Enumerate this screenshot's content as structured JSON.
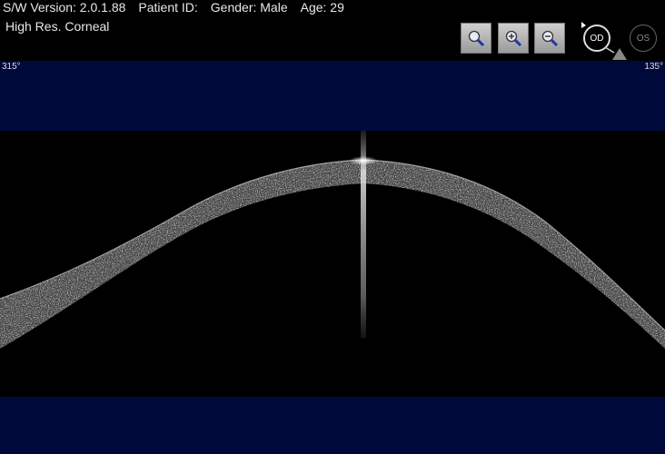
{
  "header": {
    "sw_version": "S/W Version: 2.0.1.88",
    "patient_id": "Patient ID:",
    "gender": "Gender: Male",
    "age": "Age: 29"
  },
  "scan_type": "High Res. Corneal",
  "toolbar": {
    "buttons": [
      {
        "name": "magnifier",
        "icon": "search-icon"
      },
      {
        "name": "zoom-in",
        "icon": "zoom-in-icon"
      },
      {
        "name": "zoom-out",
        "icon": "zoom-out-icon"
      }
    ],
    "eye_selector": {
      "od_label": "OD",
      "os_label": "OS",
      "selected": "OD"
    }
  },
  "angles": {
    "left": "315°",
    "right": "135°"
  },
  "colors": {
    "band": "#000a3a",
    "background": "#000000"
  }
}
